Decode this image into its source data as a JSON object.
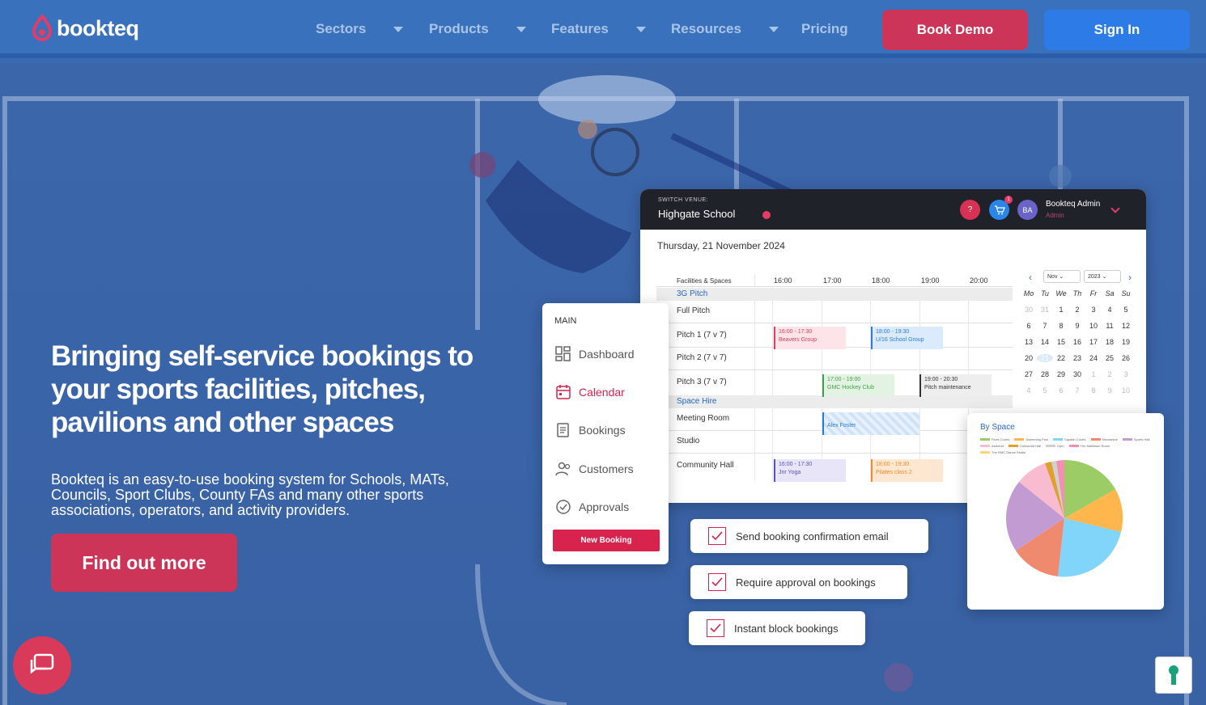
{
  "nav": {
    "logo_text": "bookteq",
    "items": [
      "Sectors",
      "Products",
      "Features",
      "Resources"
    ],
    "pricing": "Pricing",
    "book_demo": "Book Demo",
    "sign_in": "Sign In"
  },
  "hero": {
    "title": "Bringing self-service bookings to your sports facilities, pitches, pavilions and other spaces",
    "subtitle": "Bookteq is an easy-to-use booking system for Schools, MATs, Councils, Sport Clubs, County FAs and many other sports associations, operators, and activity providers.",
    "cta": "Find out more"
  },
  "app": {
    "switch_label": "SWITCH VENUE:",
    "venue": "Highgate School",
    "help": "?",
    "cart_badge": "1",
    "avatar": "BA",
    "user_name": "Bookteq Admin",
    "user_role": "Admin",
    "date": "Thursday, 21 November 2024",
    "grid_header": "Facilities & Spaces",
    "times": [
      "16:00",
      "17:00",
      "18:00",
      "19:00",
      "20:00"
    ],
    "section_1": "3G Pitch",
    "section_2": "Space Hire",
    "rows": [
      "Full Pitch",
      "Pitch 1 (7 v 7)",
      "Pitch 2 (7 v 7)",
      "Pitch 3 (7 v 7)",
      "Meeting Room",
      "Studio",
      "Community Hall"
    ],
    "events": [
      {
        "time": "16:00 - 17:30",
        "name": "Beavers Group",
        "color": "#e0405f"
      },
      {
        "time": "18:00 - 19:30",
        "name": "U/16 School Group",
        "color": "#2a7be0"
      },
      {
        "time": "17:00 - 19:00",
        "name": "GMC Hockey Club",
        "color": "#43a047"
      },
      {
        "time": "19:00 - 20:30",
        "name": "Pitch maintenance",
        "color": "#333333"
      },
      {
        "time": "",
        "name": "Alex Foster",
        "color": "#2a7be0"
      },
      {
        "time": "16:00 - 17:30",
        "name": "Jnr Yoga",
        "color": "#5c4fc4"
      },
      {
        "time": "18:00 - 19:30",
        "name": "Pilates class 2",
        "color": "#f08c2a"
      }
    ],
    "mini_cal": {
      "month": "Nov",
      "year": "2023",
      "weekdays": [
        "Mo",
        "Tu",
        "We",
        "Th",
        "Fr",
        "Sa",
        "Su"
      ],
      "weeks": [
        [
          "30",
          "31",
          "1",
          "2",
          "3",
          "4",
          "5"
        ],
        [
          "6",
          "7",
          "8",
          "9",
          "10",
          "11",
          "12"
        ],
        [
          "13",
          "14",
          "15",
          "16",
          "17",
          "18",
          "19"
        ],
        [
          "20",
          "21",
          "22",
          "23",
          "24",
          "25",
          "26"
        ],
        [
          "27",
          "28",
          "29",
          "30",
          "1",
          "2",
          "3"
        ],
        [
          "4",
          "5",
          "6",
          "7",
          "8",
          "9",
          "10"
        ]
      ]
    }
  },
  "sidebar": {
    "section": "MAIN",
    "items": [
      "Dashboard",
      "Calendar",
      "Bookings",
      "Customers",
      "Approvals"
    ],
    "new_booking": "New Booking"
  },
  "features": [
    "Send booking confirmation email",
    "Require approval on bookings",
    "Instant block bookings"
  ],
  "pie": {
    "title": "By Space",
    "legend": [
      {
        "name": "Fives Courts",
        "color": "#9ccc65"
      },
      {
        "name": "Swimming Pool",
        "color": "#ffb74d"
      },
      {
        "name": "Squash Courts",
        "color": "#81d4fa"
      },
      {
        "name": "Mezzanine",
        "color": "#ef8a6f"
      },
      {
        "name": "Sports Hall",
        "color": "#c39bd3"
      },
      {
        "name": "Astroturf",
        "color": "#f8bbd0"
      },
      {
        "name": "Coteworld Hall",
        "color": "#e0a030"
      },
      {
        "name": "Gym",
        "color": "#d0d0d0"
      },
      {
        "name": "The Mallinson Room",
        "color": "#f48fb1"
      },
      {
        "name": "The RMC Dance Studio",
        "color": "#ffd180"
      }
    ]
  }
}
